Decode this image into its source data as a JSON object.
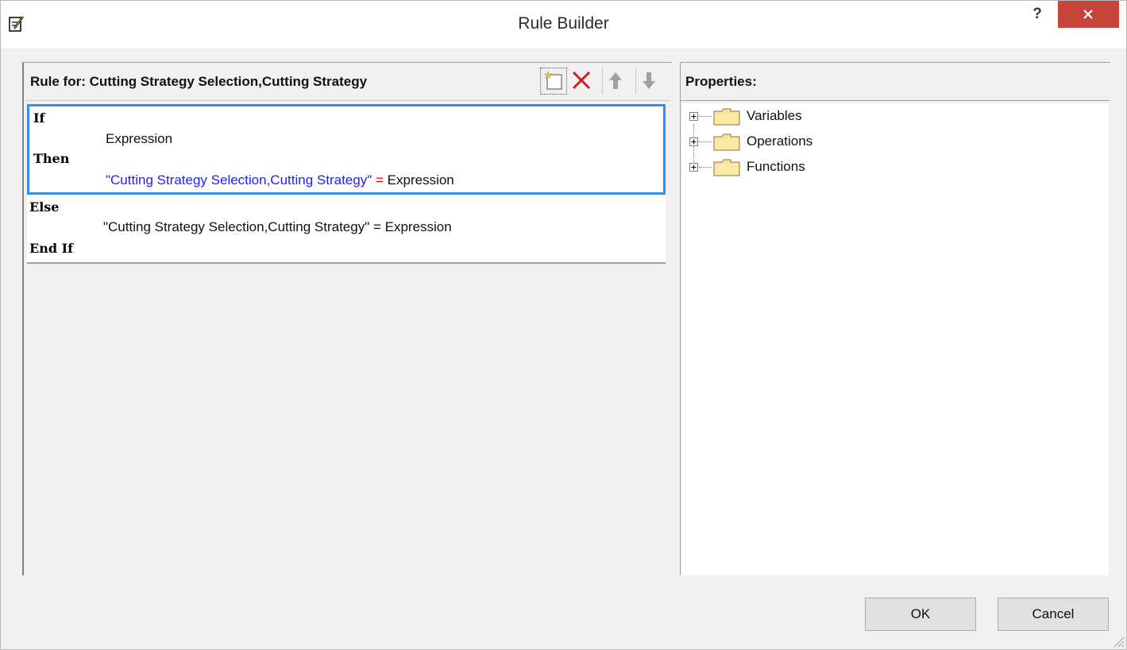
{
  "window": {
    "title": "Rule Builder",
    "help_label": "?"
  },
  "rule_pane": {
    "title": "Rule for: Cutting Strategy Selection,Cutting Strategy",
    "toolbar": [
      "new-rule-icon",
      "delete-icon",
      "move-up-icon",
      "move-down-icon"
    ],
    "if_block": {
      "if_keyword": "If",
      "condition": "Expression",
      "then_keyword": "Then",
      "assign_target": "\"Cutting Strategy Selection,Cutting Strategy\"",
      "assign_op": "=",
      "assign_value": "Expression"
    },
    "else_block": {
      "else_keyword": "Else",
      "statement": "\"Cutting Strategy Selection,Cutting Strategy\" = Expression",
      "end_keyword": "End If"
    }
  },
  "properties_pane": {
    "title": "Properties:",
    "tree": [
      {
        "label": "Variables"
      },
      {
        "label": "Operations"
      },
      {
        "label": "Functions"
      }
    ]
  },
  "buttons": {
    "ok": "OK",
    "cancel": "Cancel"
  },
  "colors": {
    "selection_border": "#3a8de6",
    "assign_target": "#2020ff",
    "assign_op": "#ff0000",
    "close_button": "#c7443b"
  }
}
